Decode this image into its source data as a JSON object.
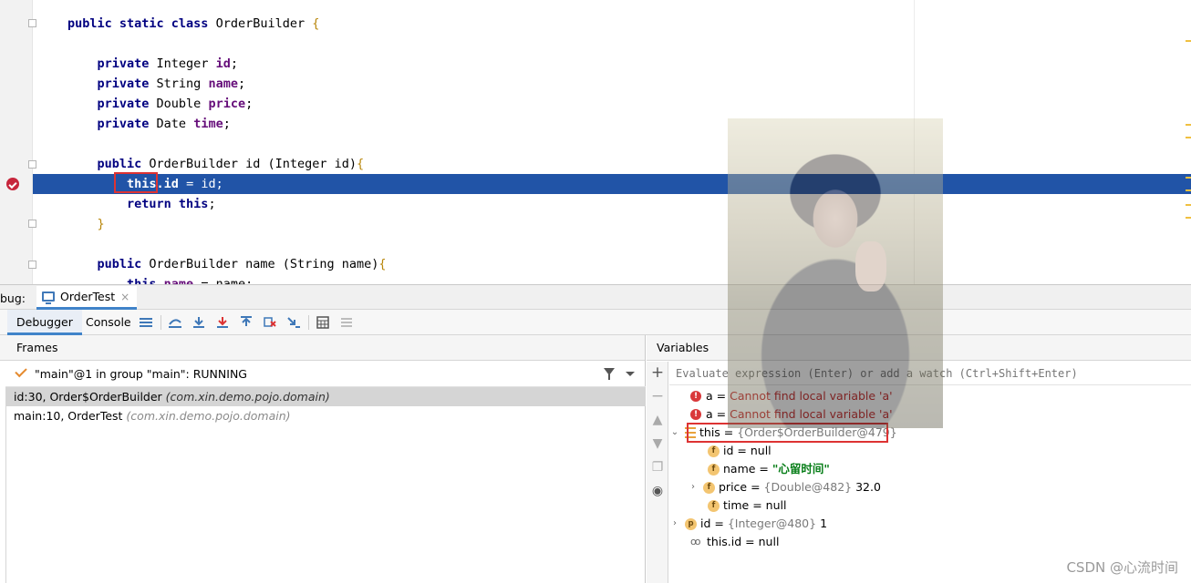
{
  "editor": {
    "lines": [
      {
        "indent": "",
        "tokens": [
          [
            "kw",
            "public static class "
          ],
          [
            "t",
            "OrderBuilder "
          ],
          [
            "brace",
            "{"
          ]
        ]
      },
      {
        "indent": "    ",
        "tokens": [
          [
            "kw",
            "private "
          ],
          [
            "t",
            "Integer "
          ],
          [
            "fld",
            "id"
          ],
          [
            "t",
            ";"
          ]
        ]
      },
      {
        "indent": "    ",
        "tokens": [
          [
            "kw",
            "private "
          ],
          [
            "t",
            "String "
          ],
          [
            "fld",
            "name"
          ],
          [
            "t",
            ";"
          ]
        ]
      },
      {
        "indent": "    ",
        "tokens": [
          [
            "kw",
            "private "
          ],
          [
            "t",
            "Double "
          ],
          [
            "fld",
            "price"
          ],
          [
            "t",
            ";"
          ]
        ]
      },
      {
        "indent": "    ",
        "tokens": [
          [
            "kw",
            "private "
          ],
          [
            "t",
            "Date "
          ],
          [
            "fld",
            "time"
          ],
          [
            "t",
            ";"
          ]
        ]
      },
      {
        "indent": "    ",
        "tokens": [
          [
            "kw",
            "public "
          ],
          [
            "t",
            "OrderBuilder id (Integer id)"
          ],
          [
            "brace",
            "{"
          ]
        ]
      },
      {
        "indent": "        ",
        "tokens": [
          [
            "kw",
            "this"
          ],
          [
            "fld",
            ".id"
          ],
          [
            "t",
            " = id;"
          ]
        ]
      },
      {
        "indent": "        ",
        "tokens": [
          [
            "kw",
            "return this"
          ],
          [
            "t",
            ";"
          ]
        ]
      },
      {
        "indent": "    ",
        "tokens": [
          [
            "brace",
            "}"
          ]
        ]
      },
      {
        "indent": "    ",
        "tokens": [
          [
            "kw",
            "public "
          ],
          [
            "t",
            "OrderBuilder name (String name)"
          ],
          [
            "brace",
            "{"
          ]
        ]
      },
      {
        "indent": "        ",
        "tokens": [
          [
            "kw",
            "this"
          ],
          [
            "fld",
            ".name"
          ],
          [
            "t",
            " = name;"
          ]
        ]
      }
    ]
  },
  "debug": {
    "label": "bug:",
    "session_tab": "OrderTest",
    "close_glyph": "×",
    "tabs": [
      "Debugger",
      "Console"
    ]
  },
  "frames": {
    "title": "Frames",
    "thread": "\"main\"@1 in group \"main\": RUNNING",
    "items": [
      {
        "method": "id:30, Order$OrderBuilder",
        "pkg": "(com.xin.demo.pojo.domain)"
      },
      {
        "method": "main:10, OrderTest",
        "pkg": "(com.xin.demo.pojo.domain)"
      }
    ]
  },
  "variables": {
    "title": "Variables",
    "eval_placeholder": "Evaluate expression (Enter) or add a watch (Ctrl+Shift+Enter)",
    "rows": [
      {
        "icon": "error-icon",
        "name": "a",
        "eq": " = ",
        "value": "Cannot find local variable 'a'"
      },
      {
        "icon": "error-icon",
        "name": "a",
        "eq": " = ",
        "value": "Cannot find local variable 'a'"
      },
      {
        "icon": "object-icon",
        "name": "this",
        "eq": " = ",
        "ref": "{Order$OrderBuilder@479}",
        "expanded": "true"
      },
      {
        "icon": "field-icon",
        "name": "id",
        "eq": " = ",
        "value": "null"
      },
      {
        "icon": "field-icon",
        "name": "name",
        "eq": " = ",
        "value": "\"心留时间\""
      },
      {
        "icon": "field-icon",
        "name": "price",
        "eq": " = ",
        "ref": "{Double@482}",
        "value": "32.0",
        "expandable": "true"
      },
      {
        "icon": "field-icon",
        "name": "time",
        "eq": " = ",
        "value": "null"
      },
      {
        "icon": "param-icon",
        "name": "id",
        "eq": " = ",
        "ref": "{Integer@480}",
        "value": "1",
        "expandable": "true"
      },
      {
        "icon": "watch-icon",
        "name": "this.id",
        "eq": " = ",
        "value": "null"
      }
    ]
  },
  "watermark": "CSDN @心流时间",
  "colors": {
    "execution_line": "#2154a7",
    "highlight_box": "#dd3333",
    "keyword": "#000080",
    "field": "#660e7a",
    "error": "#c62a2a"
  }
}
